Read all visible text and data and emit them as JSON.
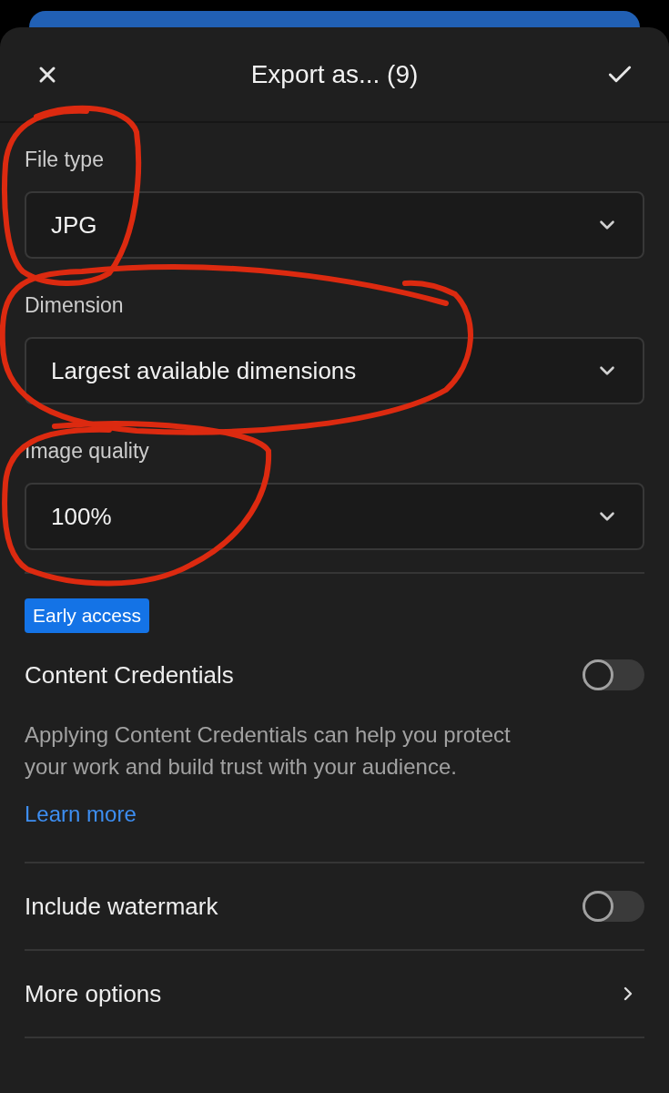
{
  "header": {
    "title": "Export as... (9)"
  },
  "fields": [
    {
      "label": "File type",
      "value": "JPG",
      "circled": true
    },
    {
      "label": "Dimension",
      "value": "Largest available dimensions",
      "circled": true
    },
    {
      "label": "Image quality",
      "value": "100%",
      "circled": true
    }
  ],
  "content_credentials": {
    "badge": "Early access",
    "title": "Content Credentials",
    "on": false,
    "description": "Applying Content Credentials can help you protect your work and build trust with your audience.",
    "link": "Learn more"
  },
  "rows": [
    {
      "kind": "toggle",
      "label": "Include watermark",
      "on": false
    },
    {
      "kind": "link",
      "label": "More options"
    }
  ]
}
